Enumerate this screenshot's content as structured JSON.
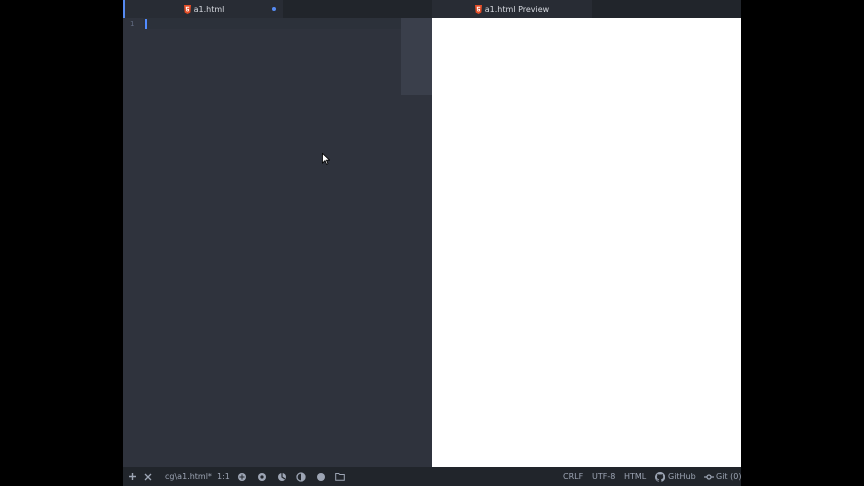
{
  "tabs": {
    "editor": {
      "label": "a1.html",
      "modified": true,
      "icon": "html5-icon"
    },
    "preview": {
      "label": "a1.html Preview",
      "icon": "html5-icon"
    }
  },
  "editor": {
    "line_numbers": [
      "1"
    ]
  },
  "statusbar": {
    "file_path": "cg\\a1.html*",
    "cursor_position": "1:1",
    "line_ending": "CRLF",
    "encoding": "UTF-8",
    "grammar": "HTML",
    "github": "GitHub",
    "git": "Git (0)"
  },
  "colors": {
    "accent": "#568af2",
    "html5": "#e44d26",
    "editor_bg": "#2f333d",
    "preview_bg": "#ffffff"
  }
}
